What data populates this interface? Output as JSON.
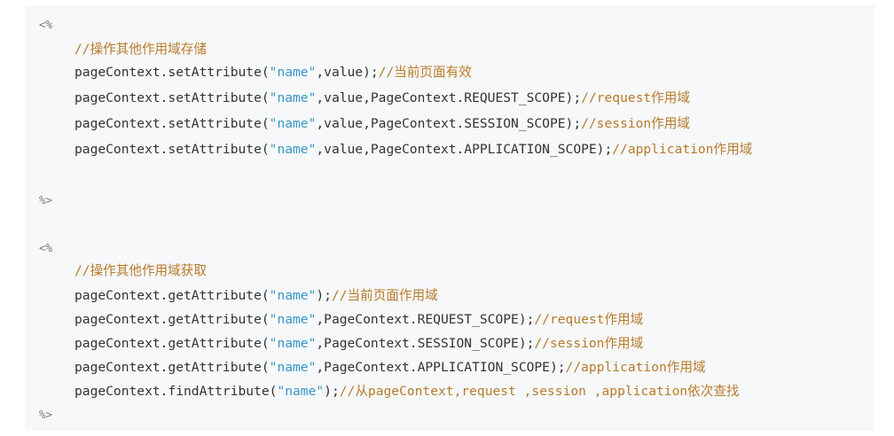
{
  "block1": {
    "open_tag": "<%",
    "comment": "//操作其他作用域存储",
    "lines": [
      {
        "code_a": "pageContext.setAttribute(",
        "str": "\"name\"",
        "code_b": ",value);",
        "comment": "//当前页面有效"
      },
      {
        "code_a": "pageContext.setAttribute(",
        "str": "\"name\"",
        "code_b": ",value,PageContext.REQUEST_SCOPE);",
        "comment": "//request作用域"
      },
      {
        "code_a": "pageContext.setAttribute(",
        "str": "\"name\"",
        "code_b": ",value,PageContext.SESSION_SCOPE);",
        "comment": "//session作用域"
      },
      {
        "code_a": "pageContext.setAttribute(",
        "str": "\"name\"",
        "code_b": ",value,PageContext.APPLICATION_SCOPE);",
        "comment": "//application作用域"
      }
    ],
    "close_tag": "%>"
  },
  "block2": {
    "open_tag": "<%",
    "comment": "//操作其他作用域获取",
    "lines": [
      {
        "code_a": "pageContext.getAttribute(",
        "str": "\"name\"",
        "code_b": ");",
        "comment": "//当前页面作用域"
      },
      {
        "code_a": "pageContext.getAttribute(",
        "str": "\"name\"",
        "code_b": ",PageContext.REQUEST_SCOPE);",
        "comment": "//request作用域"
      },
      {
        "code_a": "pageContext.getAttribute(",
        "str": "\"name\"",
        "code_b": ",PageContext.SESSION_SCOPE);",
        "comment": "//session作用域"
      },
      {
        "code_a": "pageContext.getAttribute(",
        "str": "\"name\"",
        "code_b": ",PageContext.APPLICATION_SCOPE);",
        "comment": "//application作用域"
      },
      {
        "code_a": "pageContext.findAttribute(",
        "str": "\"name\"",
        "code_b": ");",
        "comment": "//从pageContext,request ,session ,application依次查找"
      }
    ],
    "close_tag": "%>"
  }
}
